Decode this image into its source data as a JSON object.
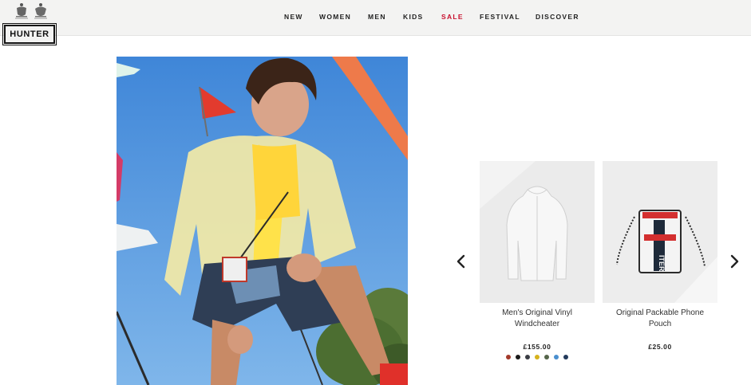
{
  "brand": {
    "logo_text": "HUNTER"
  },
  "nav": {
    "items": [
      {
        "label": "NEW",
        "color": "#222222"
      },
      {
        "label": "WOMEN",
        "color": "#222222"
      },
      {
        "label": "MEN",
        "color": "#222222"
      },
      {
        "label": "KIDS",
        "color": "#222222"
      },
      {
        "label": "SALE",
        "color": "#c8102e"
      },
      {
        "label": "FESTIVAL",
        "color": "#222222"
      },
      {
        "label": "DISCOVER",
        "color": "#222222"
      }
    ]
  },
  "carousel": {
    "prev_icon": "chevron-left-icon",
    "next_icon": "chevron-right-icon",
    "products": [
      {
        "name_line1": "Men's Original Vinyl",
        "name_line2": "Windcheater",
        "price": "£155.00",
        "swatches": [
          "#a33a2b",
          "#1a1a1a",
          "#3a3d44",
          "#d6b21c",
          "#55654a",
          "#4a8fcf",
          "#233a5c"
        ]
      },
      {
        "name_line1": "Original Packable Phone",
        "name_line2": "Pouch",
        "price": "£25.00",
        "swatches": []
      }
    ]
  },
  "colors": {
    "header_bg": "#f3f3f2",
    "accent_sale": "#c8102e"
  }
}
